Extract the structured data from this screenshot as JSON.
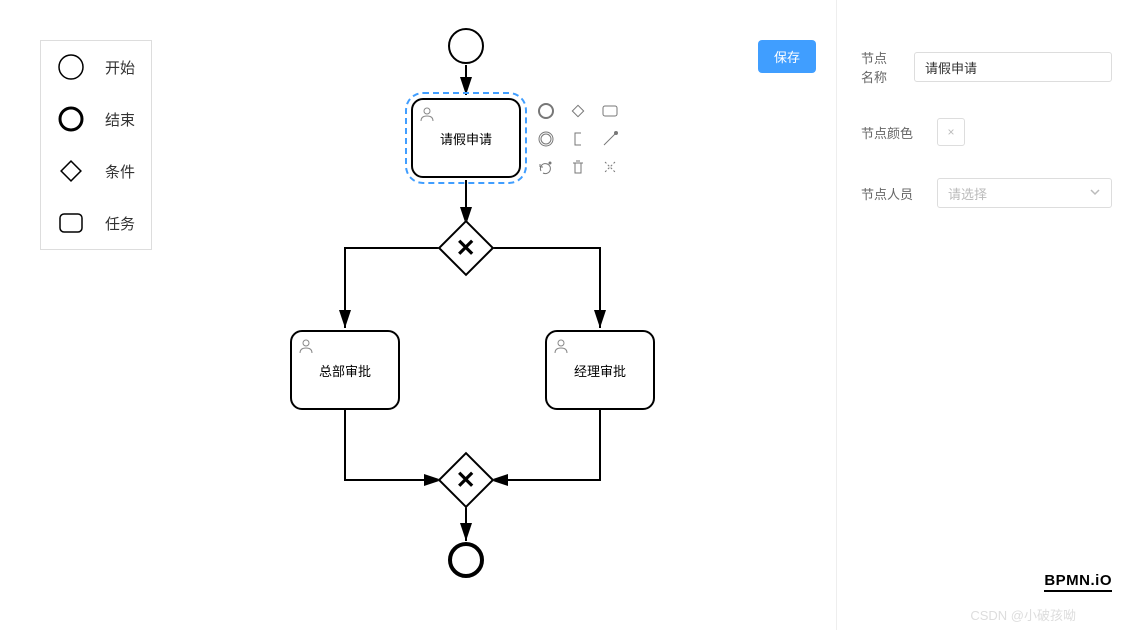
{
  "palette": {
    "start": "开始",
    "end": "结束",
    "condition": "条件",
    "task": "任务"
  },
  "save_button": "保存",
  "panel": {
    "name_label": "节点名称",
    "name_value": "请假申请",
    "color_label": "节点颜色",
    "color_clear": "×",
    "person_label": "节点人员",
    "person_placeholder": "请选择"
  },
  "diagram": {
    "task1": "请假申请",
    "task2": "总部审批",
    "task3": "经理审批"
  },
  "context_pad_icons": {
    "start": "start-event-icon",
    "gateway": "gateway-icon",
    "task": "task-icon",
    "end": "end-event-icon",
    "annotation": "annotation-icon",
    "connect": "connect-icon",
    "wrench": "wrench-icon",
    "trash": "trash-icon",
    "replace": "replace-icon"
  },
  "logo": "BPMN.iO",
  "watermark": "CSDN @小破孩呦"
}
